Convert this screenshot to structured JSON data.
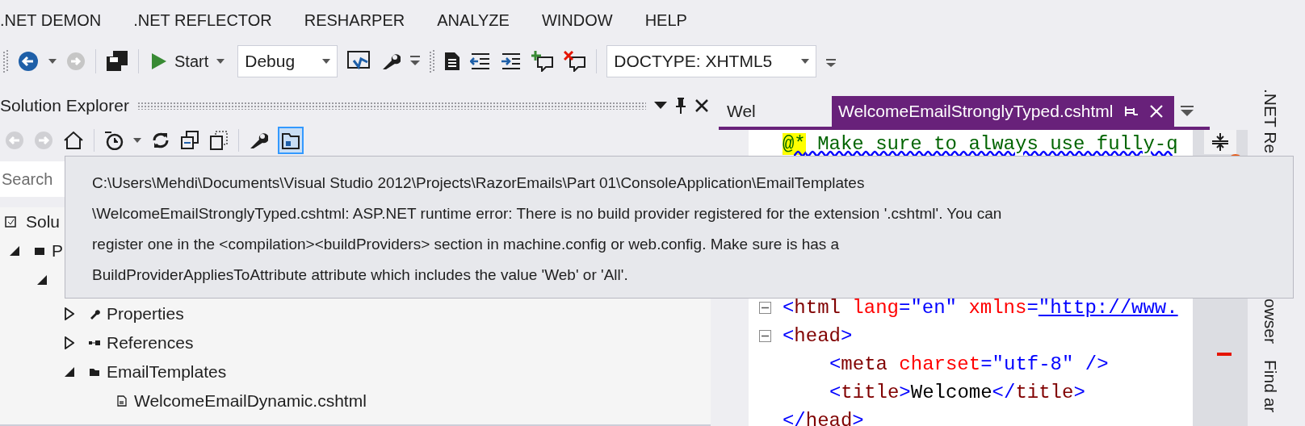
{
  "menu": [
    ".NET DEMON",
    ".NET REFLECTOR",
    "RESHARPER",
    "ANALYZE",
    "WINDOW",
    "HELP"
  ],
  "toolbar": {
    "start_label": "Start",
    "configuration": "Debug",
    "doctype": "DOCTYPE: XHTML5"
  },
  "solution_explorer": {
    "title": "Solution Explorer",
    "search_placeholder": "Search",
    "tree": [
      {
        "label": "Solu",
        "kind": "solution",
        "children": [
          {
            "label": "P",
            "kind": "project",
            "expanded": true,
            "children": [
              {
                "expanded": true,
                "children": [
                  {
                    "label": "Properties",
                    "kind": "properties",
                    "expanded": false
                  },
                  {
                    "label": "References",
                    "kind": "references",
                    "expanded": false
                  },
                  {
                    "label": "EmailTemplates",
                    "kind": "folder",
                    "expanded": true,
                    "children": [
                      {
                        "label": "WelcomeEmailDynamic.cshtml",
                        "kind": "file"
                      }
                    ]
                  }
                ]
              }
            ]
          }
        ]
      }
    ]
  },
  "editor": {
    "tabs": [
      {
        "label": "Wel",
        "selected": false
      },
      {
        "label": "WelcomeEmailStronglyTyped.cshtml",
        "selected": true
      }
    ],
    "top_lines": [
      {
        "collapsible": false,
        "tokens": [
          {
            "kind": "marker",
            "text": "@*"
          },
          {
            "kind": "comment",
            "text": " Make sure to always use fully-q"
          }
        ]
      }
    ],
    "lines": [
      {
        "collapsible": true,
        "tokens": [
          {
            "kind": "delim",
            "text": "<"
          },
          {
            "kind": "tag",
            "text": "html"
          },
          {
            "kind": "attr",
            "text": " lang"
          },
          {
            "kind": "delim",
            "text": "="
          },
          {
            "kind": "value",
            "text": "\"en\""
          },
          {
            "kind": "attr",
            "text": " xmlns"
          },
          {
            "kind": "delim",
            "text": "="
          },
          {
            "kind": "link",
            "text": "\"http://www."
          }
        ]
      },
      {
        "collapsible": true,
        "tokens": [
          {
            "kind": "delim",
            "text": "<"
          },
          {
            "kind": "tag",
            "text": "head"
          },
          {
            "kind": "delim",
            "text": ">"
          }
        ]
      },
      {
        "collapsible": false,
        "indented": true,
        "tokens": [
          {
            "kind": "delim",
            "text": "<"
          },
          {
            "kind": "tag",
            "text": "meta"
          },
          {
            "kind": "attr",
            "text": " charset"
          },
          {
            "kind": "delim",
            "text": "="
          },
          {
            "kind": "value",
            "text": "\"utf-8\""
          },
          {
            "kind": "delim",
            "text": " />"
          }
        ]
      },
      {
        "collapsible": false,
        "indented": true,
        "tokens": [
          {
            "kind": "delim",
            "text": "<"
          },
          {
            "kind": "tag",
            "text": "title"
          },
          {
            "kind": "delim",
            "text": ">"
          },
          {
            "kind": "plain",
            "text": "Welcome"
          },
          {
            "kind": "delim",
            "text": "</"
          },
          {
            "kind": "tag",
            "text": "title"
          },
          {
            "kind": "delim",
            "text": ">"
          }
        ]
      },
      {
        "collapsible": false,
        "tokens": [
          {
            "kind": "delim",
            "text": "</"
          },
          {
            "kind": "tag",
            "text": "head"
          },
          {
            "kind": "delim",
            "text": ">"
          }
        ]
      }
    ]
  },
  "side_tabs": [
    ".NET Re",
    "owser",
    "Find ar"
  ],
  "tooltip": {
    "lines": [
      "C:\\Users\\Mehdi\\Documents\\Visual Studio 2012\\Projects\\RazorEmails\\Part 01\\ConsoleApplication\\EmailTemplates",
      "\\WelcomeEmailStronglyTyped.cshtml: ASP.NET runtime error: There is no build provider registered for the extension '.cshtml'. You can",
      "register one in the <compilation><buildProviders> section in machine.config or web.config. Make sure is has a",
      "BuildProviderAppliesToAttribute attribute which includes the value 'Web' or 'All'."
    ]
  }
}
